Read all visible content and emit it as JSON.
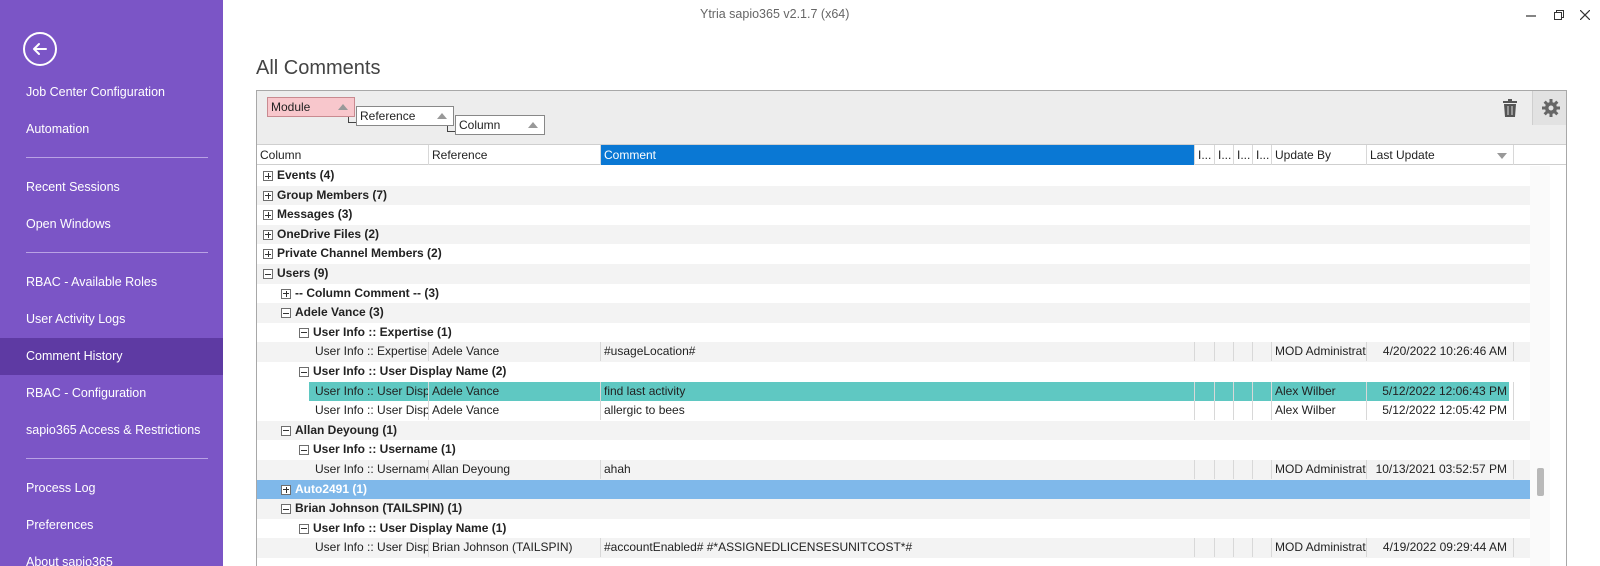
{
  "window": {
    "title": "Ytria sapio365 v2.1.7 (x64)"
  },
  "sidebar": {
    "back_icon": "arrow-left-icon",
    "items": [
      {
        "label": "Job Center Configuration"
      },
      {
        "label": "Automation"
      },
      {
        "label": "Recent Sessions"
      },
      {
        "label": "Open Windows"
      },
      {
        "label": "RBAC - Available Roles"
      },
      {
        "label": "User Activity Logs"
      },
      {
        "label": "Comment History",
        "active": true
      },
      {
        "label": "RBAC - Configuration"
      },
      {
        "label": "sapio365 Access & Restrictions"
      },
      {
        "label": "Process Log"
      },
      {
        "label": "Preferences"
      },
      {
        "label": "About sapio365"
      }
    ]
  },
  "page": {
    "title": "All Comments"
  },
  "grouping": {
    "chips": [
      "Module",
      "Reference",
      "Column"
    ]
  },
  "columns": [
    "Column",
    "Reference",
    "Comment",
    "I...",
    "I...",
    "I...",
    "I...",
    "Update By",
    "Last Update"
  ],
  "rows": [
    {
      "type": "group",
      "label": "Events (4)",
      "expanded": false
    },
    {
      "type": "group",
      "label": "Group Members (7)",
      "expanded": false
    },
    {
      "type": "group",
      "label": "Messages (3)",
      "expanded": false
    },
    {
      "type": "group",
      "label": "OneDrive Files (2)",
      "expanded": false
    },
    {
      "type": "group",
      "label": "Private Channel Members (2)",
      "expanded": false
    },
    {
      "type": "group",
      "label": "Users (9)",
      "expanded": true
    },
    {
      "type": "group",
      "label": "-- Column Comment -- (3)",
      "expanded": false
    },
    {
      "type": "group",
      "label": "Adele Vance (3)",
      "expanded": true
    },
    {
      "type": "group",
      "label": "User Info :: Expertise (1)",
      "expanded": true
    },
    {
      "type": "data",
      "column": "User Info :: Expertise",
      "reference": "Adele Vance",
      "comment": "#usageLocation#",
      "update_by": "MOD Administrat",
      "last_update": "4/20/2022 10:26:46 AM"
    },
    {
      "type": "group",
      "label": "User Info :: User Display Name (2)",
      "expanded": true
    },
    {
      "type": "data",
      "column": "User Info :: User Displa",
      "reference": "Adele Vance",
      "comment": "find last activity",
      "update_by": "Alex Wilber",
      "last_update": "5/12/2022 12:06:43 PM",
      "highlighted": true
    },
    {
      "type": "data",
      "column": "User Info :: User Displa",
      "reference": "Adele Vance",
      "comment": "allergic to bees",
      "update_by": "Alex Wilber",
      "last_update": "5/12/2022 12:05:42 PM"
    },
    {
      "type": "group",
      "label": "Allan Deyoung (1)",
      "expanded": true
    },
    {
      "type": "group",
      "label": "User Info :: Username (1)",
      "expanded": true
    },
    {
      "type": "data",
      "column": "User Info :: Username",
      "reference": "Allan Deyoung",
      "comment": "ahah",
      "update_by": "MOD Administrat",
      "last_update": "10/13/2021 03:52:57 PM"
    },
    {
      "type": "group",
      "label": "Auto2491 (1)",
      "expanded": false,
      "selected": true
    },
    {
      "type": "group",
      "label": "Brian Johnson (TAILSPIN) (1)",
      "expanded": true
    },
    {
      "type": "group",
      "label": "User Info :: User Display Name (1)",
      "expanded": true
    },
    {
      "type": "data",
      "column": "User Info :: User Displa",
      "reference": "Brian Johnson (TAILSPIN)",
      "comment": "#accountEnabled#  #*ASSIGNEDLICENSESUNITCOST*#",
      "update_by": "MOD Administrat",
      "last_update": "4/19/2022 09:29:44 AM"
    }
  ]
}
